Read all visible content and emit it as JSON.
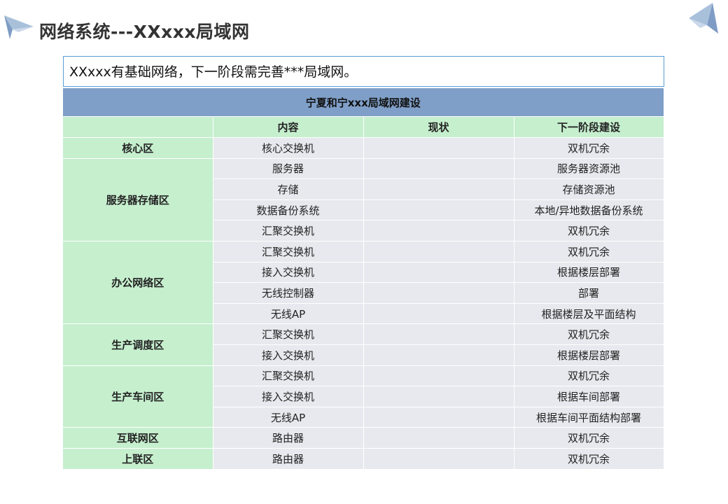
{
  "page": {
    "title": "网络系统---XXxxx局域网",
    "intro": "XXxxx有基础网络，下一阶段需完善***局域网。"
  },
  "table": {
    "caption": "宁夏和宁xxx局域网建设",
    "headers": [
      "",
      "内容",
      "现状",
      "下一阶段建设"
    ],
    "rows": [
      {
        "zone": "核心区",
        "zone_span": 1,
        "content": "核心交换机",
        "status": "",
        "next": "双机冗余"
      },
      {
        "zone": "服务器存储区",
        "zone_span": 4,
        "content": "服务器",
        "status": "",
        "next": "服务器资源池"
      },
      {
        "zone": null,
        "content": "存储",
        "status": "",
        "next": "存储资源池"
      },
      {
        "zone": null,
        "content": "数据备份系统",
        "status": "",
        "next": "本地/异地数据备份系统"
      },
      {
        "zone": null,
        "content": "汇聚交换机",
        "status": "",
        "next": "双机冗余"
      },
      {
        "zone": "办公网络区",
        "zone_span": 4,
        "content": "汇聚交换机",
        "status": "",
        "next": "双机冗余"
      },
      {
        "zone": null,
        "content": "接入交换机",
        "status": "",
        "next": "根据楼层部署"
      },
      {
        "zone": null,
        "content": "无线控制器",
        "status": "",
        "next": "部署"
      },
      {
        "zone": null,
        "content": "无线AP",
        "status": "",
        "next": "根据楼层及平面结构"
      },
      {
        "zone": "生产调度区",
        "zone_span": 2,
        "content": "汇聚交换机",
        "status": "",
        "next": "双机冗余"
      },
      {
        "zone": null,
        "content": "接入交换机",
        "status": "",
        "next": "根据楼层部署"
      },
      {
        "zone": "生产车间区",
        "zone_span": 3,
        "content": "汇聚交换机",
        "status": "",
        "next": "双机冗余"
      },
      {
        "zone": null,
        "content": "接入交换机",
        "status": "",
        "next": "根据车间部署"
      },
      {
        "zone": null,
        "content": "无线AP",
        "status": "",
        "next": "根据车间平面结构部署"
      },
      {
        "zone": "互联网区",
        "zone_span": 1,
        "content": "路由器",
        "status": "",
        "next": "双机冗余"
      },
      {
        "zone": "上联区",
        "zone_span": 1,
        "content": "路由器",
        "status": "",
        "next": "双机冗余"
      }
    ]
  },
  "colors": {
    "caption_bg": "#7f9fc8",
    "header_bg": "#c6efce",
    "cell_bg": "#e7e9ee",
    "intro_border": "#5b9bd5"
  }
}
